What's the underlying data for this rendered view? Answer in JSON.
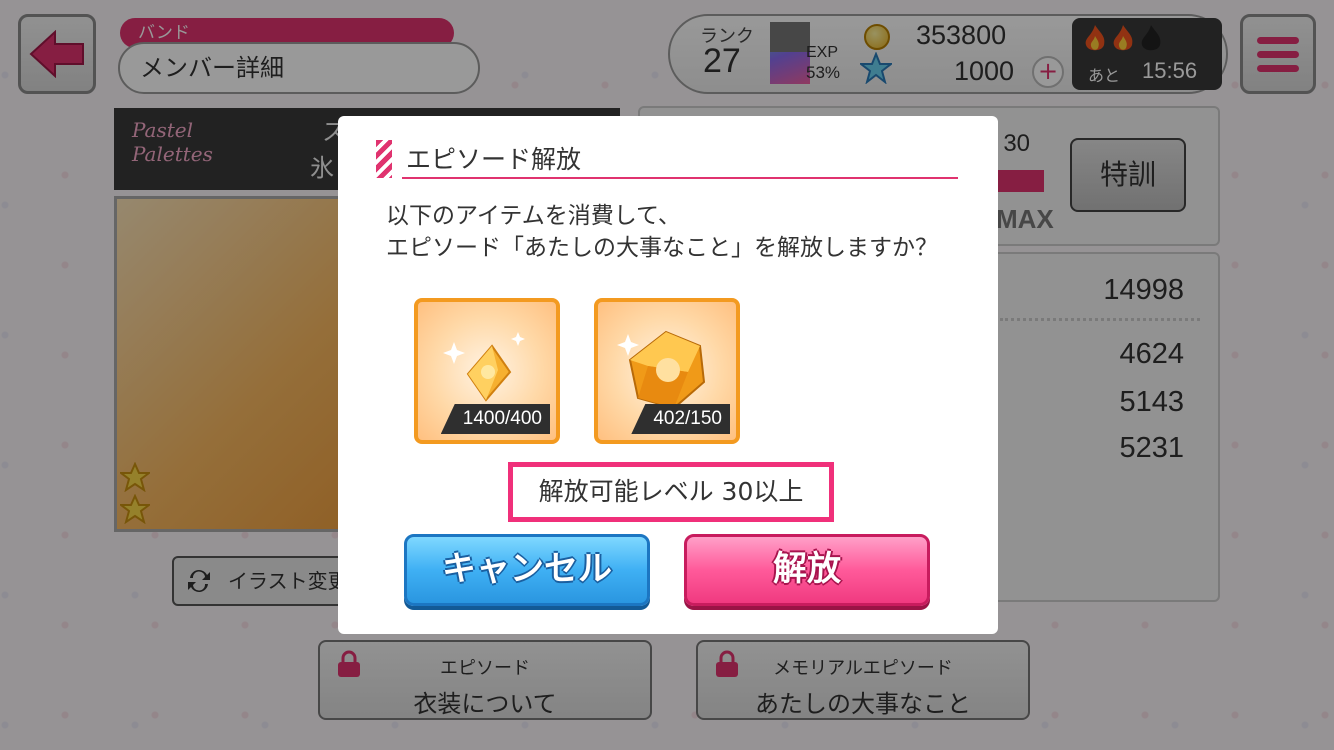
{
  "colors": {
    "accent_pink": "#e0336f",
    "cancel_blue": "#3fb0f4",
    "release_pink": "#f03a80",
    "item_orange": "#f39a20"
  },
  "header": {
    "band_label": "バンド",
    "page_title": "メンバー詳細",
    "rank_label": "ランク",
    "rank_value": "27",
    "exp_label": "EXP",
    "exp_percent": "53%",
    "coins": "353800",
    "stars": "1000",
    "live_after_label": "あと",
    "live_timer": "15:56",
    "icons": {
      "back": "back-arrow-icon",
      "menu": "hamburger-menu-icon",
      "coin": "coin-icon",
      "star": "star-gem-icon",
      "plus": "plus-icon",
      "flame": "flame-icon"
    }
  },
  "card_panel": {
    "band_logo_line1": "Pastel",
    "band_logo_line2": "Palettes",
    "member_partial_1": "ス",
    "member_partial_2": "氷",
    "illust_button_label": "イラスト変更",
    "rarity_stars": 2
  },
  "level_panel": {
    "level_fraction": "/ 30",
    "max_label": "MAX",
    "training_button_label": "特訓"
  },
  "stats": {
    "total": "14998",
    "performance": "4624",
    "technique": "5143",
    "visual": "5231"
  },
  "episodes": [
    {
      "type": "エピソード",
      "name": "衣装について"
    },
    {
      "type": "メモリアルエピソード",
      "name": "あたしの大事なこと"
    }
  ],
  "dialog": {
    "title": "エピソード解放",
    "message_line1": "以下のアイテムを消費して、",
    "message_line2": "エピソード「あたしの大事なこと」を解放しますか？",
    "items": [
      {
        "icon": "small-crystal-icon",
        "count": "1400/400"
      },
      {
        "icon": "large-crystal-icon",
        "count": "402/150"
      }
    ],
    "level_requirement": "解放可能レベル 30以上",
    "cancel_label": "キャンセル",
    "release_label": "解放"
  }
}
